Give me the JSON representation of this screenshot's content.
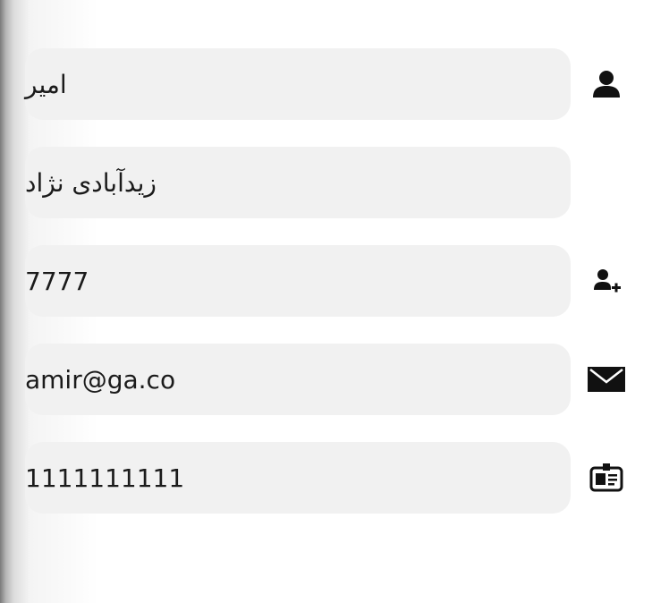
{
  "form": {
    "first_name": {
      "value": "امیر",
      "icon": "user-icon"
    },
    "last_name": {
      "value": "زیدآبادی نژاد"
    },
    "code": {
      "value": "7777",
      "icon": "user-add-icon"
    },
    "email": {
      "value": "amir@ga.co",
      "icon": "envelope-icon"
    },
    "national_id": {
      "value": "1111111111",
      "icon": "id-card-icon"
    }
  },
  "colors": {
    "field_background": "#f1f1f1",
    "text": "#1b1b1b",
    "icon": "#111111"
  }
}
